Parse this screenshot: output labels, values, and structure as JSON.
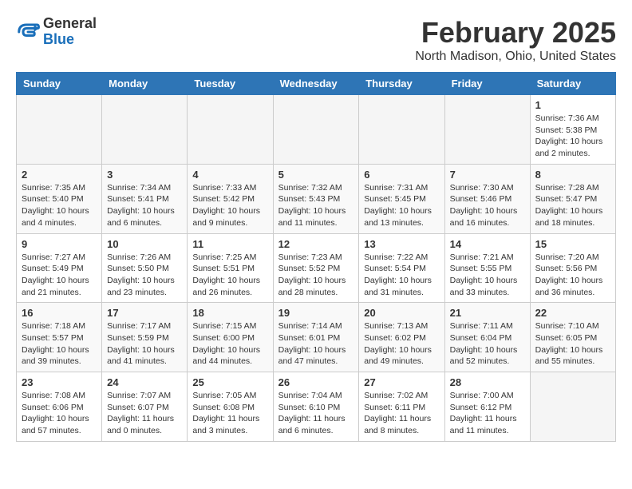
{
  "header": {
    "logo": {
      "general": "General",
      "blue": "Blue"
    },
    "title": "February 2025",
    "location": "North Madison, Ohio, United States"
  },
  "weekdays": [
    "Sunday",
    "Monday",
    "Tuesday",
    "Wednesday",
    "Thursday",
    "Friday",
    "Saturday"
  ],
  "weeks": [
    [
      {
        "day": "",
        "info": ""
      },
      {
        "day": "",
        "info": ""
      },
      {
        "day": "",
        "info": ""
      },
      {
        "day": "",
        "info": ""
      },
      {
        "day": "",
        "info": ""
      },
      {
        "day": "",
        "info": ""
      },
      {
        "day": "1",
        "info": "Sunrise: 7:36 AM\nSunset: 5:38 PM\nDaylight: 10 hours\nand 2 minutes."
      }
    ],
    [
      {
        "day": "2",
        "info": "Sunrise: 7:35 AM\nSunset: 5:40 PM\nDaylight: 10 hours\nand 4 minutes."
      },
      {
        "day": "3",
        "info": "Sunrise: 7:34 AM\nSunset: 5:41 PM\nDaylight: 10 hours\nand 6 minutes."
      },
      {
        "day": "4",
        "info": "Sunrise: 7:33 AM\nSunset: 5:42 PM\nDaylight: 10 hours\nand 9 minutes."
      },
      {
        "day": "5",
        "info": "Sunrise: 7:32 AM\nSunset: 5:43 PM\nDaylight: 10 hours\nand 11 minutes."
      },
      {
        "day": "6",
        "info": "Sunrise: 7:31 AM\nSunset: 5:45 PM\nDaylight: 10 hours\nand 13 minutes."
      },
      {
        "day": "7",
        "info": "Sunrise: 7:30 AM\nSunset: 5:46 PM\nDaylight: 10 hours\nand 16 minutes."
      },
      {
        "day": "8",
        "info": "Sunrise: 7:28 AM\nSunset: 5:47 PM\nDaylight: 10 hours\nand 18 minutes."
      }
    ],
    [
      {
        "day": "9",
        "info": "Sunrise: 7:27 AM\nSunset: 5:49 PM\nDaylight: 10 hours\nand 21 minutes."
      },
      {
        "day": "10",
        "info": "Sunrise: 7:26 AM\nSunset: 5:50 PM\nDaylight: 10 hours\nand 23 minutes."
      },
      {
        "day": "11",
        "info": "Sunrise: 7:25 AM\nSunset: 5:51 PM\nDaylight: 10 hours\nand 26 minutes."
      },
      {
        "day": "12",
        "info": "Sunrise: 7:23 AM\nSunset: 5:52 PM\nDaylight: 10 hours\nand 28 minutes."
      },
      {
        "day": "13",
        "info": "Sunrise: 7:22 AM\nSunset: 5:54 PM\nDaylight: 10 hours\nand 31 minutes."
      },
      {
        "day": "14",
        "info": "Sunrise: 7:21 AM\nSunset: 5:55 PM\nDaylight: 10 hours\nand 33 minutes."
      },
      {
        "day": "15",
        "info": "Sunrise: 7:20 AM\nSunset: 5:56 PM\nDaylight: 10 hours\nand 36 minutes."
      }
    ],
    [
      {
        "day": "16",
        "info": "Sunrise: 7:18 AM\nSunset: 5:57 PM\nDaylight: 10 hours\nand 39 minutes."
      },
      {
        "day": "17",
        "info": "Sunrise: 7:17 AM\nSunset: 5:59 PM\nDaylight: 10 hours\nand 41 minutes."
      },
      {
        "day": "18",
        "info": "Sunrise: 7:15 AM\nSunset: 6:00 PM\nDaylight: 10 hours\nand 44 minutes."
      },
      {
        "day": "19",
        "info": "Sunrise: 7:14 AM\nSunset: 6:01 PM\nDaylight: 10 hours\nand 47 minutes."
      },
      {
        "day": "20",
        "info": "Sunrise: 7:13 AM\nSunset: 6:02 PM\nDaylight: 10 hours\nand 49 minutes."
      },
      {
        "day": "21",
        "info": "Sunrise: 7:11 AM\nSunset: 6:04 PM\nDaylight: 10 hours\nand 52 minutes."
      },
      {
        "day": "22",
        "info": "Sunrise: 7:10 AM\nSunset: 6:05 PM\nDaylight: 10 hours\nand 55 minutes."
      }
    ],
    [
      {
        "day": "23",
        "info": "Sunrise: 7:08 AM\nSunset: 6:06 PM\nDaylight: 10 hours\nand 57 minutes."
      },
      {
        "day": "24",
        "info": "Sunrise: 7:07 AM\nSunset: 6:07 PM\nDaylight: 11 hours\nand 0 minutes."
      },
      {
        "day": "25",
        "info": "Sunrise: 7:05 AM\nSunset: 6:08 PM\nDaylight: 11 hours\nand 3 minutes."
      },
      {
        "day": "26",
        "info": "Sunrise: 7:04 AM\nSunset: 6:10 PM\nDaylight: 11 hours\nand 6 minutes."
      },
      {
        "day": "27",
        "info": "Sunrise: 7:02 AM\nSunset: 6:11 PM\nDaylight: 11 hours\nand 8 minutes."
      },
      {
        "day": "28",
        "info": "Sunrise: 7:00 AM\nSunset: 6:12 PM\nDaylight: 11 hours\nand 11 minutes."
      },
      {
        "day": "",
        "info": ""
      }
    ]
  ]
}
